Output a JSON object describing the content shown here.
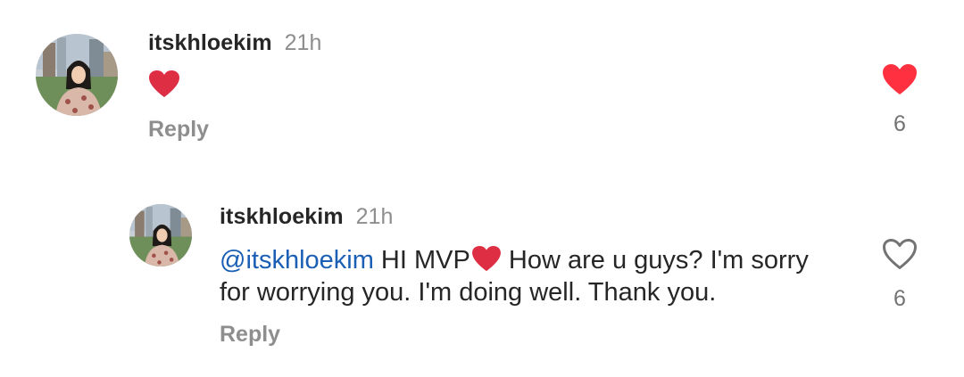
{
  "comments": [
    {
      "username": "itskhloekim",
      "time": "21h",
      "text": "",
      "has_heart_emoji": true,
      "reply_label": "Reply",
      "like_count": "6",
      "liked": true
    },
    {
      "username": "itskhloekim",
      "time": "21h",
      "mention": "@itskhloekim",
      "text_line1_part1": " HI MVP",
      "text_line1_part2": " How are u guys? I'm sorry",
      "text_line2": "for worrying you. I'm doing well. Thank you.",
      "reply_label": "Reply",
      "like_count": "6",
      "liked": false
    }
  ],
  "colors": {
    "liked_heart": "#ff3040",
    "emoji_heart": "#dd2e44",
    "mention": "#1a5fb4",
    "muted": "#8e8e8e"
  },
  "icons": {
    "avatar": "profile-photo",
    "like": "heart-icon",
    "emoji": "red-heart-emoji"
  }
}
